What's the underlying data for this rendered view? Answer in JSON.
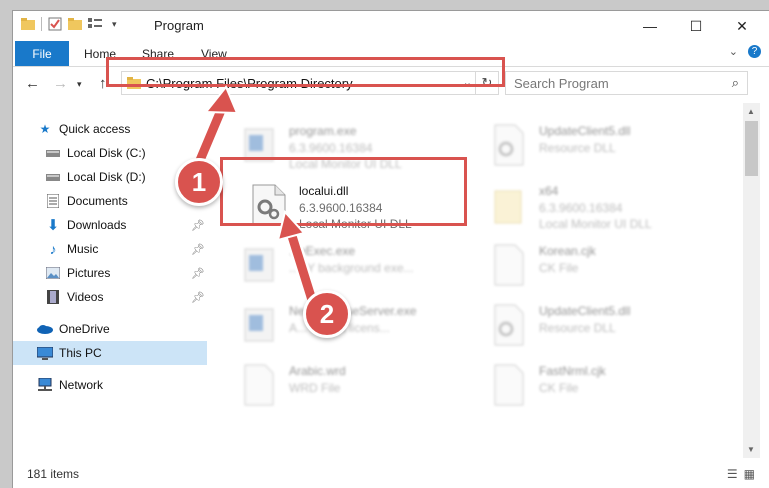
{
  "window": {
    "title": "Program"
  },
  "ribbon": {
    "tabs": [
      "File",
      "Home",
      "Share",
      "View"
    ]
  },
  "nav": {
    "address": "C:\\Program Files\\Program Directory",
    "search_placeholder": "Search Program"
  },
  "sidebar": {
    "items": [
      {
        "label": "Quick access",
        "icon": "star-icon",
        "pinned": false
      },
      {
        "label": "Local Disk (C:)",
        "icon": "drive-icon",
        "pinned": false
      },
      {
        "label": "Local Disk (D:)",
        "icon": "drive-icon",
        "pinned": false
      },
      {
        "label": "Documents",
        "icon": "documents-icon",
        "pinned": false
      },
      {
        "label": "Downloads",
        "icon": "download-icon",
        "pinned": true
      },
      {
        "label": "Music",
        "icon": "music-icon",
        "pinned": true
      },
      {
        "label": "Pictures",
        "icon": "pictures-icon",
        "pinned": true
      },
      {
        "label": "Videos",
        "icon": "videos-icon",
        "pinned": true
      },
      {
        "label": "OneDrive",
        "icon": "cloud-icon",
        "pinned": false
      },
      {
        "label": "This PC",
        "icon": "computer-icon",
        "pinned": false,
        "selected": true
      },
      {
        "label": "Network",
        "icon": "network-icon",
        "pinned": false
      }
    ]
  },
  "files": [
    {
      "name": "program.exe",
      "version": "6.3.9600.16384",
      "desc": "Local Monitor UI DLL",
      "icon": "exe-icon"
    },
    {
      "name": "UpdateClient5.dll",
      "version": "",
      "desc": "Resource DLL",
      "icon": "dll-icon"
    },
    {
      "name": "localui.dll",
      "version": "6.3.9600.16384",
      "desc": "Local Monitor UI DLL",
      "icon": "dll-icon"
    },
    {
      "name": "x64",
      "version": "6.3.9600.16384",
      "desc": "Local Monitor UI DLL",
      "icon": "folder-icon"
    },
    {
      "name": "...eExec.exe",
      "version": "",
      "desc": "...BY background exe...",
      "icon": "exe-icon"
    },
    {
      "name": "Korean.cjk",
      "version": "",
      "desc": "CK File",
      "icon": "file-icon"
    },
    {
      "name": "Net...LicenseServer.exe",
      "version": "",
      "desc": "A... ...work licens...",
      "icon": "exe-icon"
    },
    {
      "name": "UpdateClient5.dll",
      "version": "",
      "desc": "Resource DLL",
      "icon": "dll-icon"
    },
    {
      "name": "Arabic.wrd",
      "version": "",
      "desc": "WRD File",
      "icon": "file-icon"
    },
    {
      "name": "FastNrml.cjk",
      "version": "",
      "desc": "CK File",
      "icon": "file-icon"
    }
  ],
  "status": {
    "count": "181 items"
  },
  "annotations": {
    "badge1": "1",
    "badge2": "2"
  },
  "colors": {
    "accent": "#1979ca",
    "highlight": "#d9534f",
    "selected": "#cce4f7"
  }
}
